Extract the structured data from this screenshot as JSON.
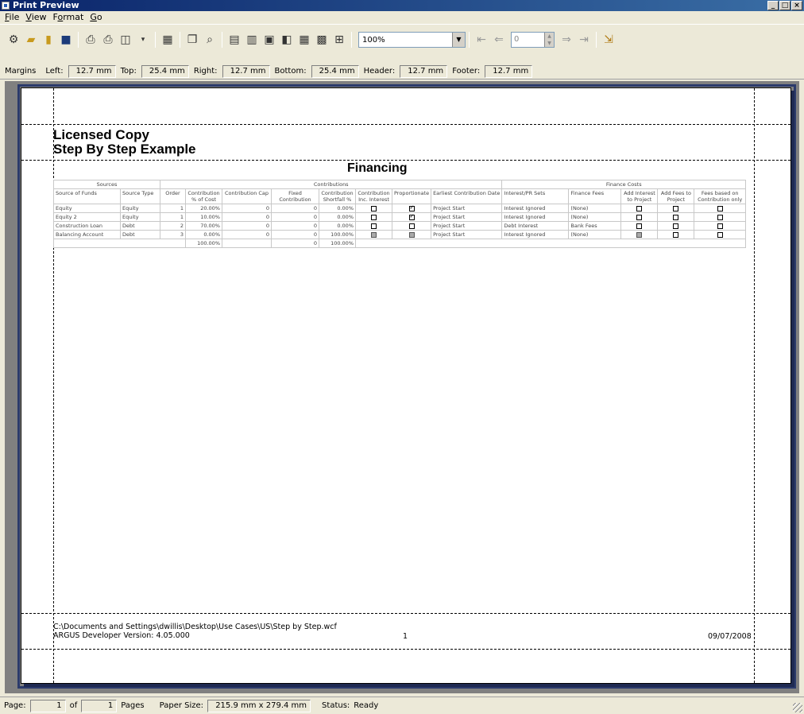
{
  "window": {
    "title": "Print Preview"
  },
  "menu": [
    {
      "prefix": "",
      "mnemonic": "F",
      "rest": "ile"
    },
    {
      "prefix": "",
      "mnemonic": "V",
      "rest": "iew"
    },
    {
      "prefix": "F",
      "mnemonic": "o",
      "rest": "rmat"
    },
    {
      "prefix": "",
      "mnemonic": "G",
      "rest": "o"
    }
  ],
  "toolbar": {
    "zoom": "100%",
    "page_input": "0",
    "icons": [
      "settings-icon",
      "open-icon",
      "export-icon",
      "save-icon",
      "print-icon",
      "print-setup-icon",
      "book-icon",
      "single-page-icon",
      "copy-icon",
      "find-icon",
      "page-layout-1-icon",
      "page-layout-2-icon",
      "page-layout-3-icon",
      "page-layout-4-icon",
      "page-layout-5-icon",
      "page-layout-6-icon",
      "multi-page-icon",
      "first-page-icon",
      "previous-page-icon",
      "next-page-icon",
      "last-page-icon",
      "exit-icon"
    ]
  },
  "margins": {
    "label": "Margins",
    "left_label": "Left:",
    "left": "12.7 mm",
    "top_label": "Top:",
    "top": "25.4 mm",
    "right_label": "Right:",
    "right": "12.7 mm",
    "bottom_label": "Bottom:",
    "bottom": "25.4 mm",
    "header_label": "Header:",
    "header": "12.7 mm",
    "footer_label": "Footer:",
    "footer": "12.7 mm"
  },
  "report": {
    "line1": "Licensed Copy",
    "line2": "Step By Step Example",
    "title": "Financing",
    "groups": {
      "sources": "Sources",
      "contributions": "Contributions",
      "finance_costs": "Finance Costs"
    },
    "columns": [
      "Source of Funds",
      "Source Type",
      "Order",
      "Contribution % of Cost",
      "Contribution Cap",
      "Fixed Contribution",
      "Contribution Shortfall %",
      "Contribution Inc. Interest",
      "Proportionate",
      "Earliest Contribution Date",
      "Interest/PR Sets",
      "Finance Fees",
      "Add Interest to Project",
      "Add Fees to Project",
      "Fees based on Contribution only"
    ],
    "rows": [
      {
        "source": "Equity",
        "type": "Equity",
        "order": "1",
        "pct": "20.00%",
        "cap": "0",
        "fixed": "0",
        "shortfall": "0.00%",
        "inc_interest": "unchecked",
        "proportionate": "checked",
        "date": "Project Start",
        "interest": "Interest Ignored",
        "fees": "(None)",
        "add_interest": "unchecked",
        "add_fees": "unchecked",
        "fees_based": "unchecked"
      },
      {
        "source": "Equity 2",
        "type": "Equity",
        "order": "1",
        "pct": "10.00%",
        "cap": "0",
        "fixed": "0",
        "shortfall": "0.00%",
        "inc_interest": "unchecked",
        "proportionate": "checked",
        "date": "Project Start",
        "interest": "Interest Ignored",
        "fees": "(None)",
        "add_interest": "unchecked",
        "add_fees": "unchecked",
        "fees_based": "unchecked"
      },
      {
        "source": "Construction Loan",
        "type": "Debt",
        "order": "2",
        "pct": "70.00%",
        "cap": "0",
        "fixed": "0",
        "shortfall": "0.00%",
        "inc_interest": "unchecked",
        "proportionate": "unchecked",
        "date": "Project Start",
        "interest": "Debt Interest",
        "fees": "Bank Fees",
        "add_interest": "unchecked",
        "add_fees": "unchecked",
        "fees_based": "unchecked"
      },
      {
        "source": "Balancing Account",
        "type": "Debt",
        "order": "3",
        "pct": "0.00%",
        "cap": "0",
        "fixed": "0",
        "shortfall": "100.00%",
        "inc_interest": "disabled",
        "proportionate": "disabled",
        "date": "Project Start",
        "interest": "Interest Ignored",
        "fees": "(None)",
        "add_interest": "disabled",
        "add_fees": "unchecked",
        "fees_based": "unchecked"
      }
    ],
    "totals": {
      "pct": "100.00%",
      "fixed": "0",
      "shortfall": "100.00%"
    },
    "footer": {
      "path": "C:\\Documents and Settings\\dwillis\\Desktop\\Use Cases\\US\\Step by Step.wcf",
      "version": "ARGUS Developer Version: 4.05.000",
      "page": "1",
      "date": "09/07/2008"
    }
  },
  "status": {
    "page_label": "Page:",
    "page": "1",
    "of_label": "of",
    "pages": "1",
    "pages_label": "Pages",
    "paper_label": "Paper Size:",
    "paper": "215.9 mm x 279.4 mm",
    "status_label": "Status:",
    "status": "Ready"
  }
}
